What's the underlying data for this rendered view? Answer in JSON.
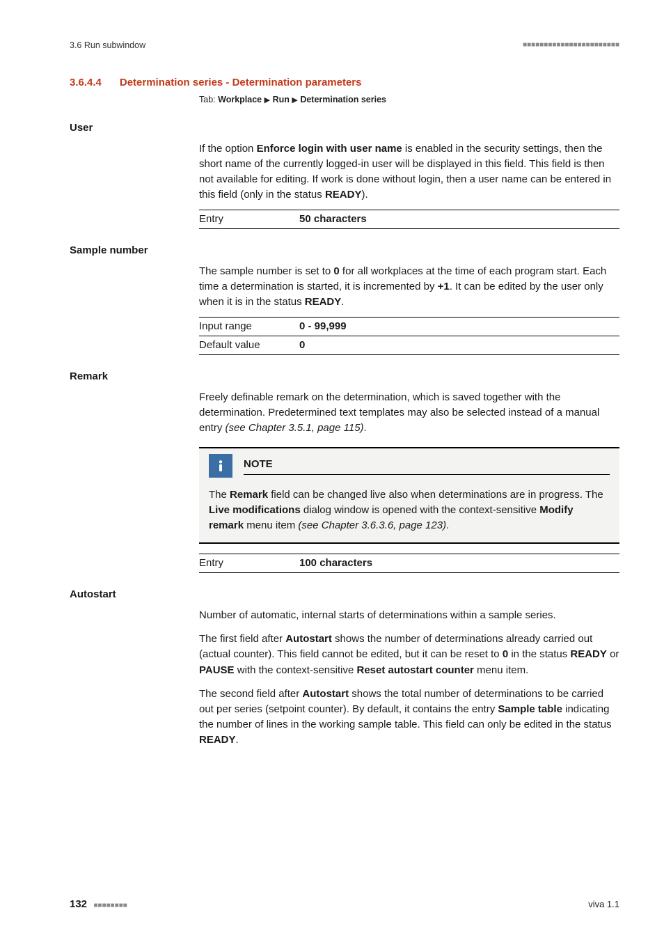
{
  "header": {
    "left": "3.6 Run subwindow",
    "squares": "■■■■■■■■■■■■■■■■■■■■■■■"
  },
  "section": {
    "number": "3.6.4.4",
    "title": "Determination series - Determination parameters",
    "tab_prefix": "Tab:",
    "tab_path": [
      "Workplace",
      "Run",
      "Determination series"
    ]
  },
  "fields": {
    "user": {
      "label": "User",
      "para": "If the option <b>Enforce login with user name</b> is enabled in the security settings, then the short name of the currently logged-in user will be displayed in this field. This field is then not available for editing. If work is done without login, then a user name can be entered in this field (only in the status <b>READY</b>).",
      "rows": [
        {
          "label": "Entry",
          "value": "50 characters"
        }
      ]
    },
    "sample_number": {
      "label": "Sample number",
      "para": "The sample number is set to <b>0</b> for all workplaces at the time of each program start. Each time a determination is started, it is incremented by <b>+1</b>. It can be edited by the user only when it is in the status <b>READY</b>.",
      "rows": [
        {
          "label": "Input range",
          "value": "0 - 99,999"
        },
        {
          "label": "Default value",
          "value": "0"
        }
      ]
    },
    "remark": {
      "label": "Remark",
      "para": "Freely definable remark on the determination, which is saved together with the determination. Predetermined text templates may also be selected instead of a manual entry <i>(see Chapter 3.5.1, page 115)</i>.",
      "note_title": "NOTE",
      "note_body": "The <b>Remark</b> field can be changed live also when determinations are in progress. The <b>Live modifications</b> dialog window is opened with the context-sensitive <b>Modify remark</b> menu item <i>(see Chapter 3.6.3.6, page 123)</i>.",
      "rows": [
        {
          "label": "Entry",
          "value": "100 characters"
        }
      ]
    },
    "autostart": {
      "label": "Autostart",
      "para1": "Number of automatic, internal starts of determinations within a sample series.",
      "para2": "The first field after <b>Autostart</b> shows the number of determinations already carried out (actual counter). This field cannot be edited, but it can be reset to <b>0</b> in the status <b>READY</b> or <b>PAUSE</b> with the context-sensitive <b>Reset autostart counter</b> menu item.",
      "para3": "The second field after <b>Autostart</b> shows the total number of determinations to be carried out per series (setpoint counter). By default, it contains the entry <b>Sample table</b> indicating the number of lines in the working sample table. This field can only be edited in the status <b>READY</b>."
    }
  },
  "footer": {
    "page": "132",
    "squares": "■■■■■■■■",
    "right": "viva 1.1"
  }
}
